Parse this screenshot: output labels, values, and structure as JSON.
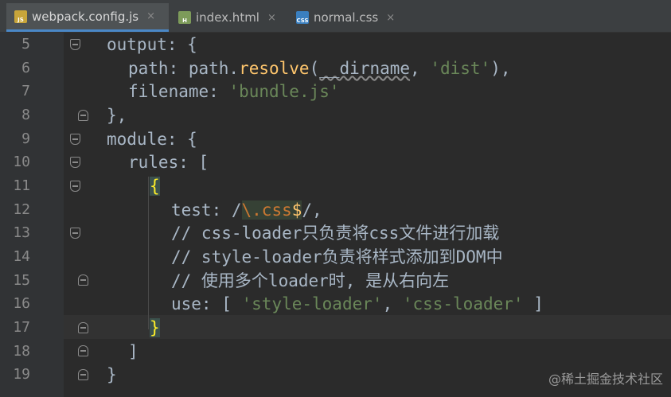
{
  "tabs": [
    {
      "label": "webpack.config.js",
      "icon": "js-file-icon",
      "badge": "JS",
      "active": true
    },
    {
      "label": "index.html",
      "icon": "html-file-icon",
      "badge": "H",
      "active": false
    },
    {
      "label": "normal.css",
      "icon": "css-file-icon",
      "badge": "CSS",
      "active": false
    }
  ],
  "close_glyph": "×",
  "lines": [
    {
      "num": "5"
    },
    {
      "num": "6"
    },
    {
      "num": "7"
    },
    {
      "num": "8"
    },
    {
      "num": "9"
    },
    {
      "num": "10"
    },
    {
      "num": "11"
    },
    {
      "num": "12"
    },
    {
      "num": "13"
    },
    {
      "num": "14"
    },
    {
      "num": "15"
    },
    {
      "num": "16"
    },
    {
      "num": "17"
    },
    {
      "num": "18"
    },
    {
      "num": "19"
    }
  ],
  "code": {
    "l5": "output: {",
    "l6_a": "path: path.",
    "l6_fn": "resolve",
    "l6_b": "(",
    "l6_dir": "__dirname",
    "l6_c": ", ",
    "l6_str": "'dist'",
    "l6_d": "),",
    "l7_a": "filename: ",
    "l7_str": "'bundle.js'",
    "l8": "},",
    "l9": "module: {",
    "l10": "rules: [",
    "l11": "{",
    "l12_a": "test: /",
    "l12_rx1": "\\.css",
    "l12_rx2": "$",
    "l12_b": "/,",
    "l13": "// css-loader只负责将css文件进行加载",
    "l14": "// style-loader负责将样式添加到DOM中",
    "l15": "// 使用多个loader时, 是从右向左",
    "l16_a": "use: [ ",
    "l16_s1": "'style-loader'",
    "l16_b": ", ",
    "l16_s2": "'css-loader'",
    "l16_c": " ]",
    "l17": "}",
    "l18": "]",
    "l19": "}"
  },
  "watermark": "@稀土掘金技术社区"
}
